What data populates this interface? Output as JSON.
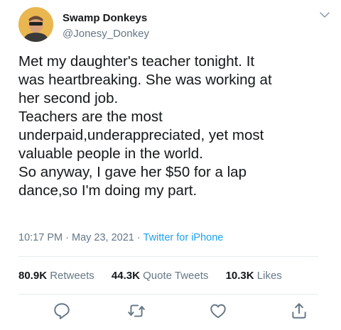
{
  "author": {
    "display_name": "Swamp Donkeys",
    "handle": "@Jonesy_Donkey",
    "avatar_icon": "profile-photo"
  },
  "tweet": {
    "text": "Met my daughter's teacher tonight. It\nwas heartbreaking. She was working at\nher second job.\nTeachers are the most\nunderpaid,underappreciated, yet most\nvaluable people in the world.\nSo anyway, I gave her $50 for a lap\ndance,so I'm doing my part.",
    "time": "10:17 PM",
    "date": "May 23, 2021",
    "separator": "·",
    "source": "Twitter for iPhone"
  },
  "stats": {
    "retweets_count": "80.9K",
    "retweets_label": "Retweets",
    "quote_count": "44.3K",
    "quote_label": "Quote Tweets",
    "likes_count": "10.3K",
    "likes_label": "Likes"
  },
  "actions": [
    "reply-icon",
    "retweet-icon",
    "like-icon",
    "share-icon"
  ],
  "colors": {
    "text": "#14171a",
    "secondary": "#657786",
    "link": "#1da1f2",
    "divider": "#e6ecf0"
  }
}
